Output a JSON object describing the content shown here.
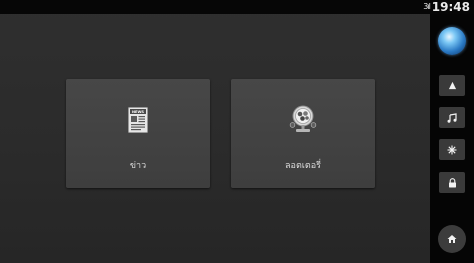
{
  "status_bar": {
    "signal_glyph": "3ıl",
    "time": "19:48"
  },
  "tiles": [
    {
      "label": "ข่าว",
      "icon": "newspaper-icon"
    },
    {
      "label": "ลอตเตอรี่",
      "icon": "lottery-machine-icon"
    }
  ],
  "sidebar": {
    "top_icon": "globe-sphere-icon",
    "buttons": [
      {
        "icon": "navigation-arrow-icon"
      },
      {
        "icon": "music-note-icon"
      },
      {
        "icon": "climate-fan-icon"
      },
      {
        "icon": "lock-icon"
      }
    ],
    "bottom_icon": "home-icon"
  },
  "colors": {
    "background": "#2e2e2e",
    "tile": "#444444",
    "sidebar": "#050505",
    "side_button": "#3a3a3a",
    "accent_blue": "#3a8fd8"
  }
}
